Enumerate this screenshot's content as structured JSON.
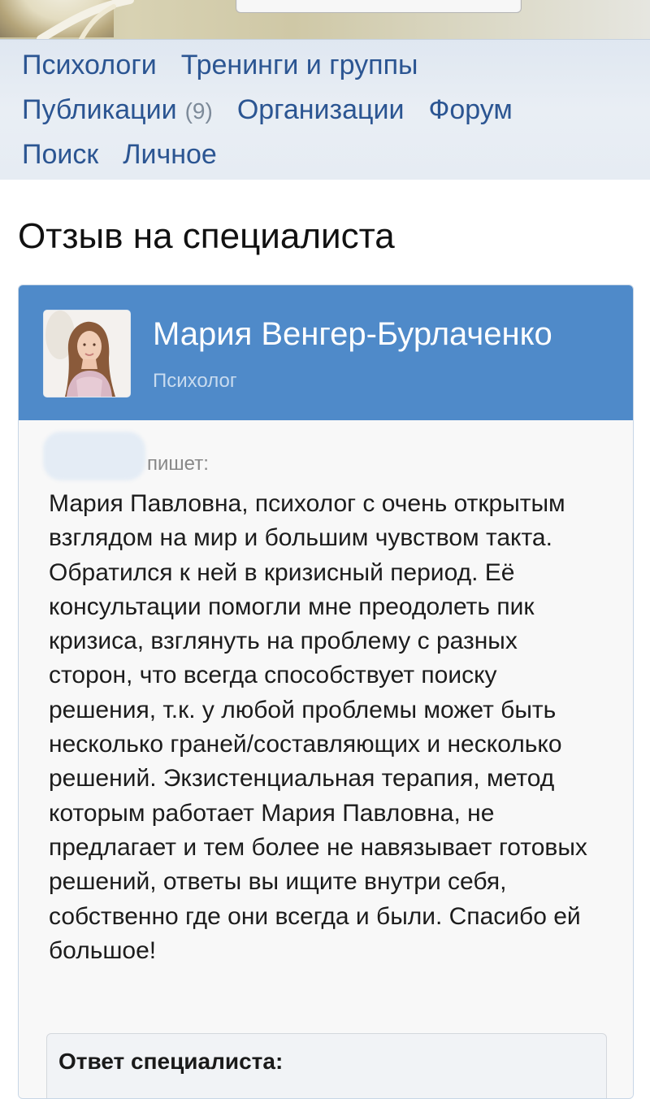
{
  "nav": {
    "links": [
      {
        "label": "Психологи"
      },
      {
        "label": "Тренинги и группы"
      },
      {
        "label": "Публикации",
        "count": "(9)"
      },
      {
        "label": "Организации"
      },
      {
        "label": "Форум"
      },
      {
        "label": "Поиск"
      },
      {
        "label": "Личное"
      }
    ]
  },
  "page": {
    "title": "Отзыв на специалиста"
  },
  "specialist": {
    "name": "Мария Венгер-Бурлаченко",
    "role": "Психолог"
  },
  "review": {
    "writes_label": "пишет:",
    "text": "Мария Павловна, психолог с очень открытым взглядом на мир и большим чувством такта. Обратился к ней в кризисный период. Её консультации помогли мне преодолеть пик кризиса, взглянуть на проблему с разных сторон, что всегда способствует поиску решения, т.к. у любой проблемы может быть несколько граней/составляющих и несколько решений. Экзистенциальная терапия, метод которым работает Мария Павловна, не предлагает и тем более не навязывает готовых решений, ответы вы ищите внутри себя, собственно где они всегда и были. Спасибо ей большое!"
  },
  "answer": {
    "label": "Ответ специалиста:"
  },
  "colors": {
    "nav_link": "#2b5592",
    "card_header": "#4f8ac9",
    "nav_background": "#e6ecf3"
  }
}
